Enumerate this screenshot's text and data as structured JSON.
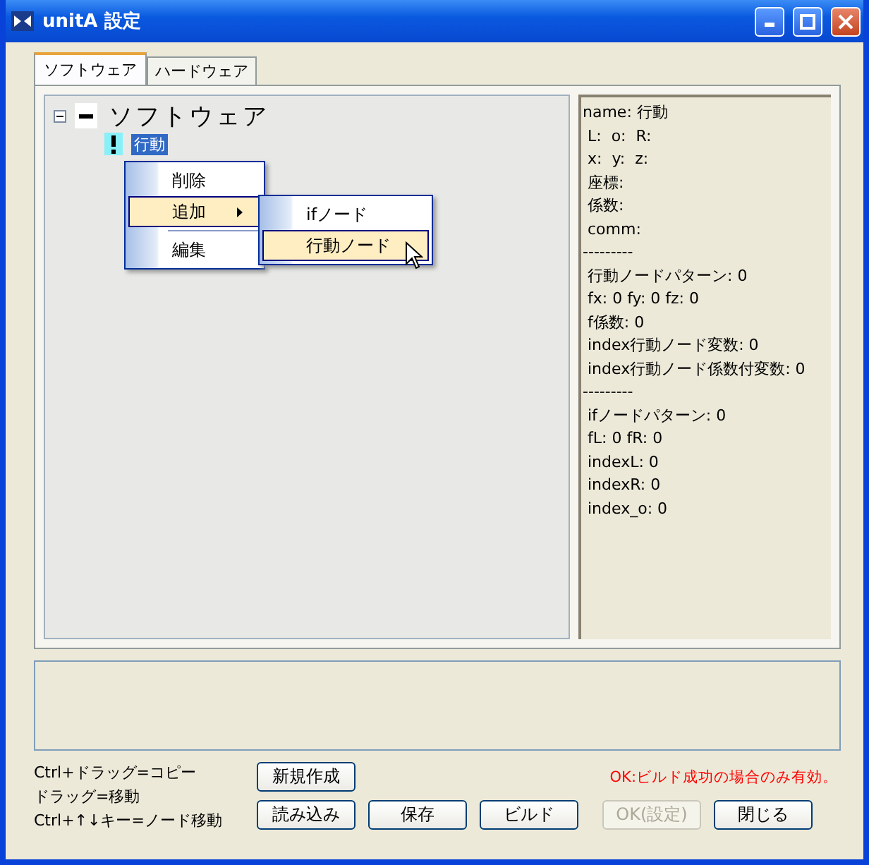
{
  "window": {
    "title": "unitA 設定"
  },
  "tabs": [
    {
      "label": "ソフトウェア",
      "selected": true
    },
    {
      "label": "ハードウェア",
      "selected": false
    }
  ],
  "tree": {
    "label": "ソフトウェア",
    "expanded": true,
    "children": [
      {
        "label": "行動",
        "selected": true
      }
    ]
  },
  "context_menu": {
    "items": [
      {
        "label": "削除",
        "highlighted": false,
        "submenu": false
      },
      {
        "label": "追加",
        "highlighted": true,
        "submenu": true
      },
      {
        "label": "編集",
        "highlighted": false,
        "submenu": false,
        "separator_before": true
      }
    ],
    "submenu": [
      {
        "label": "ifノード",
        "highlighted": false
      },
      {
        "label": "行動ノード",
        "highlighted": true
      }
    ]
  },
  "info_lines": [
    "name: 行動",
    " L:  o:  R:",
    " x:  y:  z:",
    " 座標:",
    " 係数:",
    " comm:",
    "---------",
    " 行動ノードパターン: 0",
    " fx: 0 fy: 0 fz: 0",
    " f係数: 0",
    " index行動ノード変数: 0",
    " index行動ノード係数付変数: 0",
    "---------",
    " ifノードパターン: 0",
    " fL: 0 fR: 0",
    " indexL: 0",
    " indexR: 0",
    " index_o: 0"
  ],
  "hints": [
    "Ctrl+ドラッグ=コピー",
    "ドラッグ=移動",
    "Ctrl+↑↓キー=ノード移動"
  ],
  "new_button": "新規作成",
  "notice": "OK:ビルド成功の場合のみ有効。",
  "buttons": [
    {
      "label": "読み込み",
      "disabled": false
    },
    {
      "label": "保存",
      "disabled": false
    },
    {
      "label": "ビルド",
      "disabled": false
    },
    {
      "label": "OK(設定)",
      "disabled": true
    },
    {
      "label": "閉じる",
      "disabled": false
    }
  ]
}
